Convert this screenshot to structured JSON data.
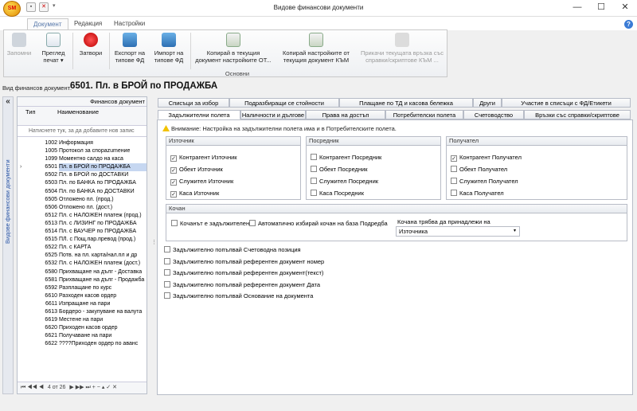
{
  "titlebar": {
    "title": "Видове финансови документи",
    "logo_text": "SM",
    "minimize": "—",
    "maximize": "☐",
    "close": "✕"
  },
  "ribbon_tabs": [
    "Документ",
    "Редакция",
    "Настройки"
  ],
  "ribbon": {
    "buttons": [
      {
        "label": "Запомни",
        "disabled": true
      },
      {
        "label": "Преглед печат ▾",
        "disabled": false
      },
      {
        "label": "Затвори",
        "disabled": false
      },
      {
        "label": "Експорт на типове ФД",
        "disabled": false
      },
      {
        "label": "Импорт на типове ФД",
        "disabled": false
      },
      {
        "label": "Копирай в текущия документ настройките ОТ...",
        "disabled": false
      },
      {
        "label": "Копирай настройките от текущия документ КЪМ",
        "disabled": false
      },
      {
        "label": "Прикачи текущата връзка със справки/скриптове КЪМ ...",
        "disabled": true
      }
    ],
    "group_label": "Основни"
  },
  "doc_type": {
    "label": "Вид финансов документ:",
    "value": "6501. Пл. в БРОЙ по ПРОДАЖБА"
  },
  "side_panel": {
    "title": "Видове финансови документи",
    "collapse": "«"
  },
  "grid": {
    "band_header": "Финансов документ",
    "col_type": "Тип",
    "col_name": "Наименование",
    "new_row_placeholder": "Натиснете тук, за да добавите нов запис",
    "rows": [
      {
        "code": "1002",
        "name": "Информация"
      },
      {
        "code": "1005",
        "name": "Протокол за спорazumение"
      },
      {
        "code": "1099",
        "name": "Моментно салдо на каса"
      },
      {
        "code": "6501",
        "name": "Пл. в БРОЙ по ПРОДАЖБА"
      },
      {
        "code": "6502",
        "name": "Пл. в БРОЙ по ДОСТАВКИ"
      },
      {
        "code": "6503",
        "name": "Пл. по БАНКА по ПРОДАЖБА"
      },
      {
        "code": "6504",
        "name": "Пл. по БАНКА по ДОСТАВКИ"
      },
      {
        "code": "6505",
        "name": "Отложено пл. (прод.)"
      },
      {
        "code": "6506",
        "name": "Отложено пл. (дост.)"
      },
      {
        "code": "6512",
        "name": "Пл. с НАЛОЖЕН платеж (прод.)"
      },
      {
        "code": "6513",
        "name": "Пл. с ЛИЗИНГ по ПРОДАЖБА"
      },
      {
        "code": "6514",
        "name": "Пл. с ВАУЧЕР по ПРОДАЖБА"
      },
      {
        "code": "6515",
        "name": "ПЛ. с Пощ.пар.превод (прод.)"
      },
      {
        "code": "6522",
        "name": "Пл. с КАРТА"
      },
      {
        "code": "6525",
        "name": "Потв. на пл. карта/нал.пл и др"
      },
      {
        "code": "6532",
        "name": "Пл. с НАЛОЖЕН платеж (дост.)"
      },
      {
        "code": "6580",
        "name": "Прихващане на дълг - Доставка"
      },
      {
        "code": "6581",
        "name": "Прихващане на дълг - Продажба"
      },
      {
        "code": "6592",
        "name": "Разплащане по курс"
      },
      {
        "code": "6610",
        "name": "Разходен касов ордер"
      },
      {
        "code": "6611",
        "name": "Изпращане на пари"
      },
      {
        "code": "6613",
        "name": "Бордеро - закупуване на валута"
      },
      {
        "code": "6619",
        "name": "Местене на пари"
      },
      {
        "code": "6620",
        "name": "Приходен касов ордер"
      },
      {
        "code": "6621",
        "name": "Получаване на пари"
      },
      {
        "code": "6622",
        "name": "????Приходен ордер по аванс"
      }
    ],
    "selected_index": 3,
    "nav_text": "4 от 26"
  },
  "tabs_row1": [
    "Списъци за избор",
    "Подразбиращи се стойности",
    "Плащане по ТД и касова бележка",
    "Други",
    "Участие в списъци с ФД/Етикети"
  ],
  "tabs_row2": [
    "Задължителни полета",
    "Наличности и дългове",
    "Права на достъп",
    "Потребителски полета",
    "Счетоводство",
    "Връзки със справки/скриптове"
  ],
  "content": {
    "warning": "Внимание: Настройка на задължителни полета има и в Потребителските полета.",
    "source": {
      "title": "Източник",
      "items": [
        {
          "label": "Контрагент Източник",
          "checked": true
        },
        {
          "label": "Обект Източник",
          "checked": true
        },
        {
          "label": "Служител Източник",
          "checked": true
        },
        {
          "label": "Каса Източник",
          "checked": true
        }
      ]
    },
    "intermediary": {
      "title": "Посредник",
      "items": [
        {
          "label": "Контрагент Посредник",
          "checked": false
        },
        {
          "label": "Обект Посредник",
          "checked": false
        },
        {
          "label": "Служител Посредник",
          "checked": false
        },
        {
          "label": "Каса Посредник",
          "checked": false
        }
      ]
    },
    "receiver": {
      "title": "Получател",
      "items": [
        {
          "label": "Контрагент Получател",
          "checked": true
        },
        {
          "label": "Обект Получател",
          "checked": false
        },
        {
          "label": "Служител Получател",
          "checked": false
        },
        {
          "label": "Каса Получател",
          "checked": false
        }
      ]
    },
    "kochan": {
      "title": "Кочан",
      "required": {
        "label": "Кочанът е задължителен",
        "checked": false
      },
      "auto": {
        "label": "Автоматично избирай кочан на база Подредба",
        "checked": false
      },
      "belongs_label": "Кочана трябва да принадлежи на",
      "belongs_value": "Източника"
    },
    "mandatory": [
      {
        "label": "Задължително попълвай Счетоводна позиция",
        "checked": false
      },
      {
        "label": "Задължително попълвай референтен документ номер",
        "checked": false
      },
      {
        "label": "Задължително попълвай референтен документ(текст)",
        "checked": false
      },
      {
        "label": "Задължително попълвай референтен документ Дата",
        "checked": false
      },
      {
        "label": "Задължително попълвай Основание на документа",
        "checked": false
      }
    ]
  },
  "colors": {
    "accent": "#5577aa",
    "selection": "#c6d7f1"
  }
}
